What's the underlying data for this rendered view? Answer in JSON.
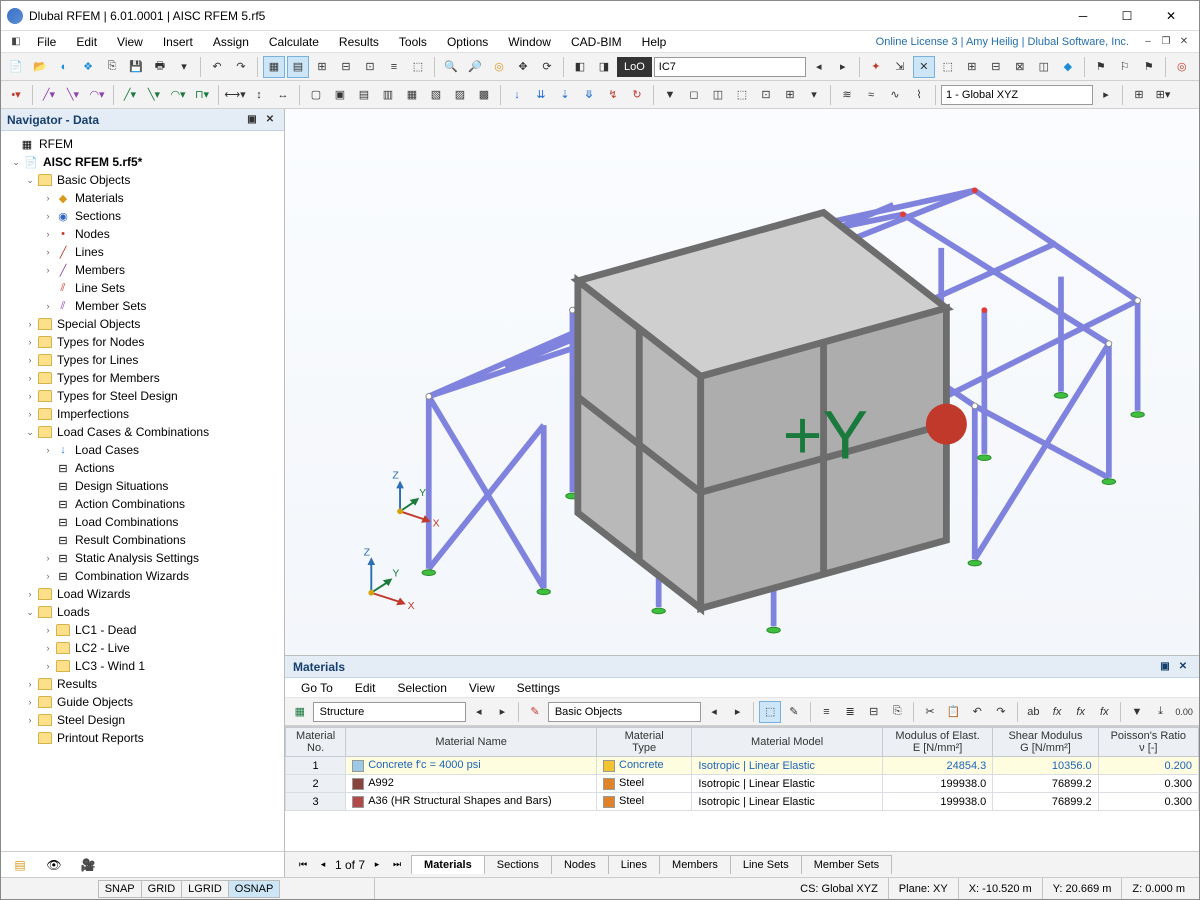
{
  "titlebar": {
    "title": "Dlubal RFEM | 6.01.0001 | AISC RFEM 5.rf5"
  },
  "menubar": {
    "items": [
      "File",
      "Edit",
      "View",
      "Insert",
      "Assign",
      "Calculate",
      "Results",
      "Tools",
      "Options",
      "Window",
      "CAD-BIM",
      "Help"
    ],
    "license": "Online License 3 | Amy Heilig | Dlubal Software, Inc."
  },
  "toolbar1": {
    "loadcase_prefix": "LoO",
    "loadcase": "IC7"
  },
  "toolbar2": {
    "cs": "1 - Global XYZ"
  },
  "navigator": {
    "title": "Navigator - Data",
    "root": "RFEM",
    "model": "AISC RFEM 5.rf5*",
    "basic_objects": {
      "label": "Basic Objects",
      "children": [
        "Materials",
        "Sections",
        "Nodes",
        "Lines",
        "Members",
        "Line Sets",
        "Member Sets"
      ]
    },
    "middle": [
      "Special Objects",
      "Types for Nodes",
      "Types for Lines",
      "Types for Members",
      "Types for Steel Design",
      "Imperfections"
    ],
    "lcc": {
      "label": "Load Cases & Combinations",
      "children": [
        "Load Cases",
        "Actions",
        "Design Situations",
        "Action Combinations",
        "Load Combinations",
        "Result Combinations",
        "Static Analysis Settings",
        "Combination Wizards"
      ]
    },
    "load_wizards": "Load Wizards",
    "loads": {
      "label": "Loads",
      "children": [
        "LC1 - Dead",
        "LC2 - Live",
        "LC3 - Wind 1"
      ]
    },
    "bottom": [
      "Results",
      "Guide Objects",
      "Steel Design",
      "Printout Reports"
    ]
  },
  "materials_panel": {
    "title": "Materials",
    "menu": [
      "Go To",
      "Edit",
      "Selection",
      "View",
      "Settings"
    ],
    "drop1": "Structure",
    "drop2": "Basic Objects",
    "columns": [
      "Material\nNo.",
      "Material Name",
      "Material\nType",
      "Material Model",
      "Modulus of Elast.\nE [N/mm²]",
      "Shear Modulus\nG [N/mm²]",
      "Poisson's Ratio\nν [-]"
    ],
    "rows": [
      {
        "no": "1",
        "name": "Concrete f'c = 4000 psi",
        "sw": "#9cc9e6",
        "type": "Concrete",
        "tsw": "#f4c430",
        "model": "Isotropic | Linear Elastic",
        "E": "24854.3",
        "G": "10356.0",
        "nu": "0.200",
        "sel": true
      },
      {
        "no": "2",
        "name": "A992",
        "sw": "#8a423c",
        "type": "Steel",
        "tsw": "#e0822a",
        "model": "Isotropic | Linear Elastic",
        "E": "199938.0",
        "G": "76899.2",
        "nu": "0.300"
      },
      {
        "no": "3",
        "name": "A36 (HR Structural Shapes and Bars)",
        "sw": "#b24a4a",
        "type": "Steel",
        "tsw": "#e0822a",
        "model": "Isotropic | Linear Elastic",
        "E": "199938.0",
        "G": "76899.2",
        "nu": "0.300"
      }
    ],
    "pager": "1 of 7",
    "tabs": [
      "Materials",
      "Sections",
      "Nodes",
      "Lines",
      "Members",
      "Line Sets",
      "Member Sets"
    ]
  },
  "status": {
    "snap": [
      "SNAP",
      "GRID",
      "LGRID",
      "OSNAP"
    ],
    "cs": "CS: Global XYZ",
    "plane": "Plane: XY",
    "x": "X: -10.520 m",
    "y": "Y: 20.669 m",
    "z": "Z: 0.000 m"
  }
}
